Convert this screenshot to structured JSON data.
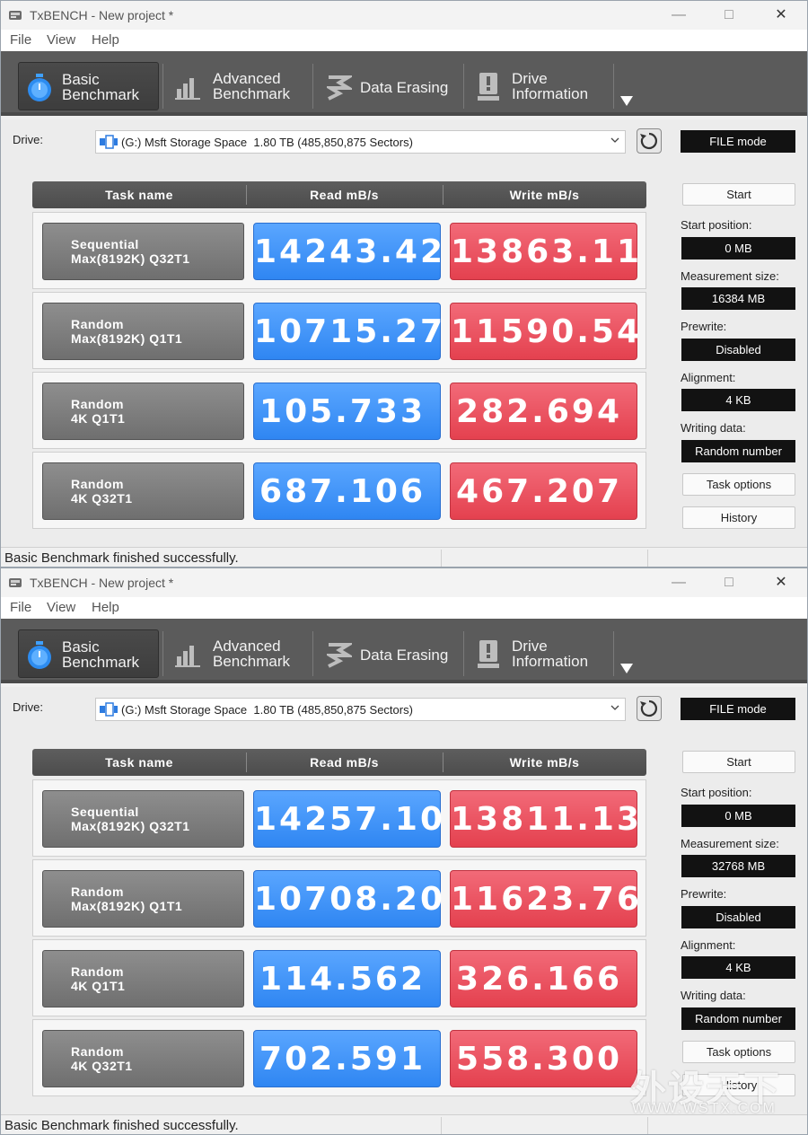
{
  "windows": [
    {
      "title": "TxBENCH - New project *",
      "menu": [
        "File",
        "View",
        "Help"
      ],
      "tabs": [
        {
          "line1": "Basic",
          "line2": "Benchmark"
        },
        {
          "line1": "Advanced",
          "line2": "Benchmark"
        },
        {
          "line1": "Data Erasing",
          "line2": ""
        },
        {
          "line1": "Drive",
          "line2": "Information"
        }
      ],
      "drive_label": "Drive:",
      "drive_value": "(G:) Msft Storage Space  1.80 TB (485,850,875 Sectors)",
      "mode": "FILE mode",
      "headers": {
        "task": "Task name",
        "read": "Read mB/s",
        "write": "Write mB/s"
      },
      "rows": [
        {
          "line1": "Sequential",
          "line2": "Max(8192K) Q32T1",
          "read": "14243.42",
          "write": "13863.11"
        },
        {
          "line1": "Random",
          "line2": "Max(8192K) Q1T1",
          "read": "10715.27",
          "write": "11590.54"
        },
        {
          "line1": "Random",
          "line2": "4K Q1T1",
          "read": "105.733",
          "write": "282.694"
        },
        {
          "line1": "Random",
          "line2": "4K Q32T1",
          "read": "687.106",
          "write": "467.207"
        }
      ],
      "side": {
        "start": "Start",
        "start_position_label": "Start position:",
        "start_position": "0 MB",
        "measurement_size_label": "Measurement size:",
        "measurement_size": "16384 MB",
        "prewrite_label": "Prewrite:",
        "prewrite": "Disabled",
        "alignment_label": "Alignment:",
        "alignment": "4 KB",
        "writing_data_label": "Writing data:",
        "writing_data": "Random number",
        "task_options": "Task options",
        "history": "History"
      },
      "status": "Basic Benchmark finished successfully."
    },
    {
      "title": "TxBENCH - New project *",
      "menu": [
        "File",
        "View",
        "Help"
      ],
      "tabs": [
        {
          "line1": "Basic",
          "line2": "Benchmark"
        },
        {
          "line1": "Advanced",
          "line2": "Benchmark"
        },
        {
          "line1": "Data Erasing",
          "line2": ""
        },
        {
          "line1": "Drive",
          "line2": "Information"
        }
      ],
      "drive_label": "Drive:",
      "drive_value": "(G:) Msft Storage Space  1.80 TB (485,850,875 Sectors)",
      "mode": "FILE mode",
      "headers": {
        "task": "Task name",
        "read": "Read mB/s",
        "write": "Write mB/s"
      },
      "rows": [
        {
          "line1": "Sequential",
          "line2": "Max(8192K) Q32T1",
          "read": "14257.10",
          "write": "13811.13"
        },
        {
          "line1": "Random",
          "line2": "Max(8192K) Q1T1",
          "read": "10708.20",
          "write": "11623.76"
        },
        {
          "line1": "Random",
          "line2": "4K Q1T1",
          "read": "114.562",
          "write": "326.166"
        },
        {
          "line1": "Random",
          "line2": "4K Q32T1",
          "read": "702.591",
          "write": "558.300"
        }
      ],
      "side": {
        "start": "Start",
        "start_position_label": "Start position:",
        "start_position": "0 MB",
        "measurement_size_label": "Measurement size:",
        "measurement_size": "32768 MB",
        "prewrite_label": "Prewrite:",
        "prewrite": "Disabled",
        "alignment_label": "Alignment:",
        "alignment": "4 KB",
        "writing_data_label": "Writing data:",
        "writing_data": "Random number",
        "task_options": "Task options",
        "history": "History"
      },
      "status": "Basic Benchmark finished successfully."
    }
  ],
  "watermark": {
    "line1": "外设天下",
    "line2": "WWW.WSTX.COM"
  }
}
